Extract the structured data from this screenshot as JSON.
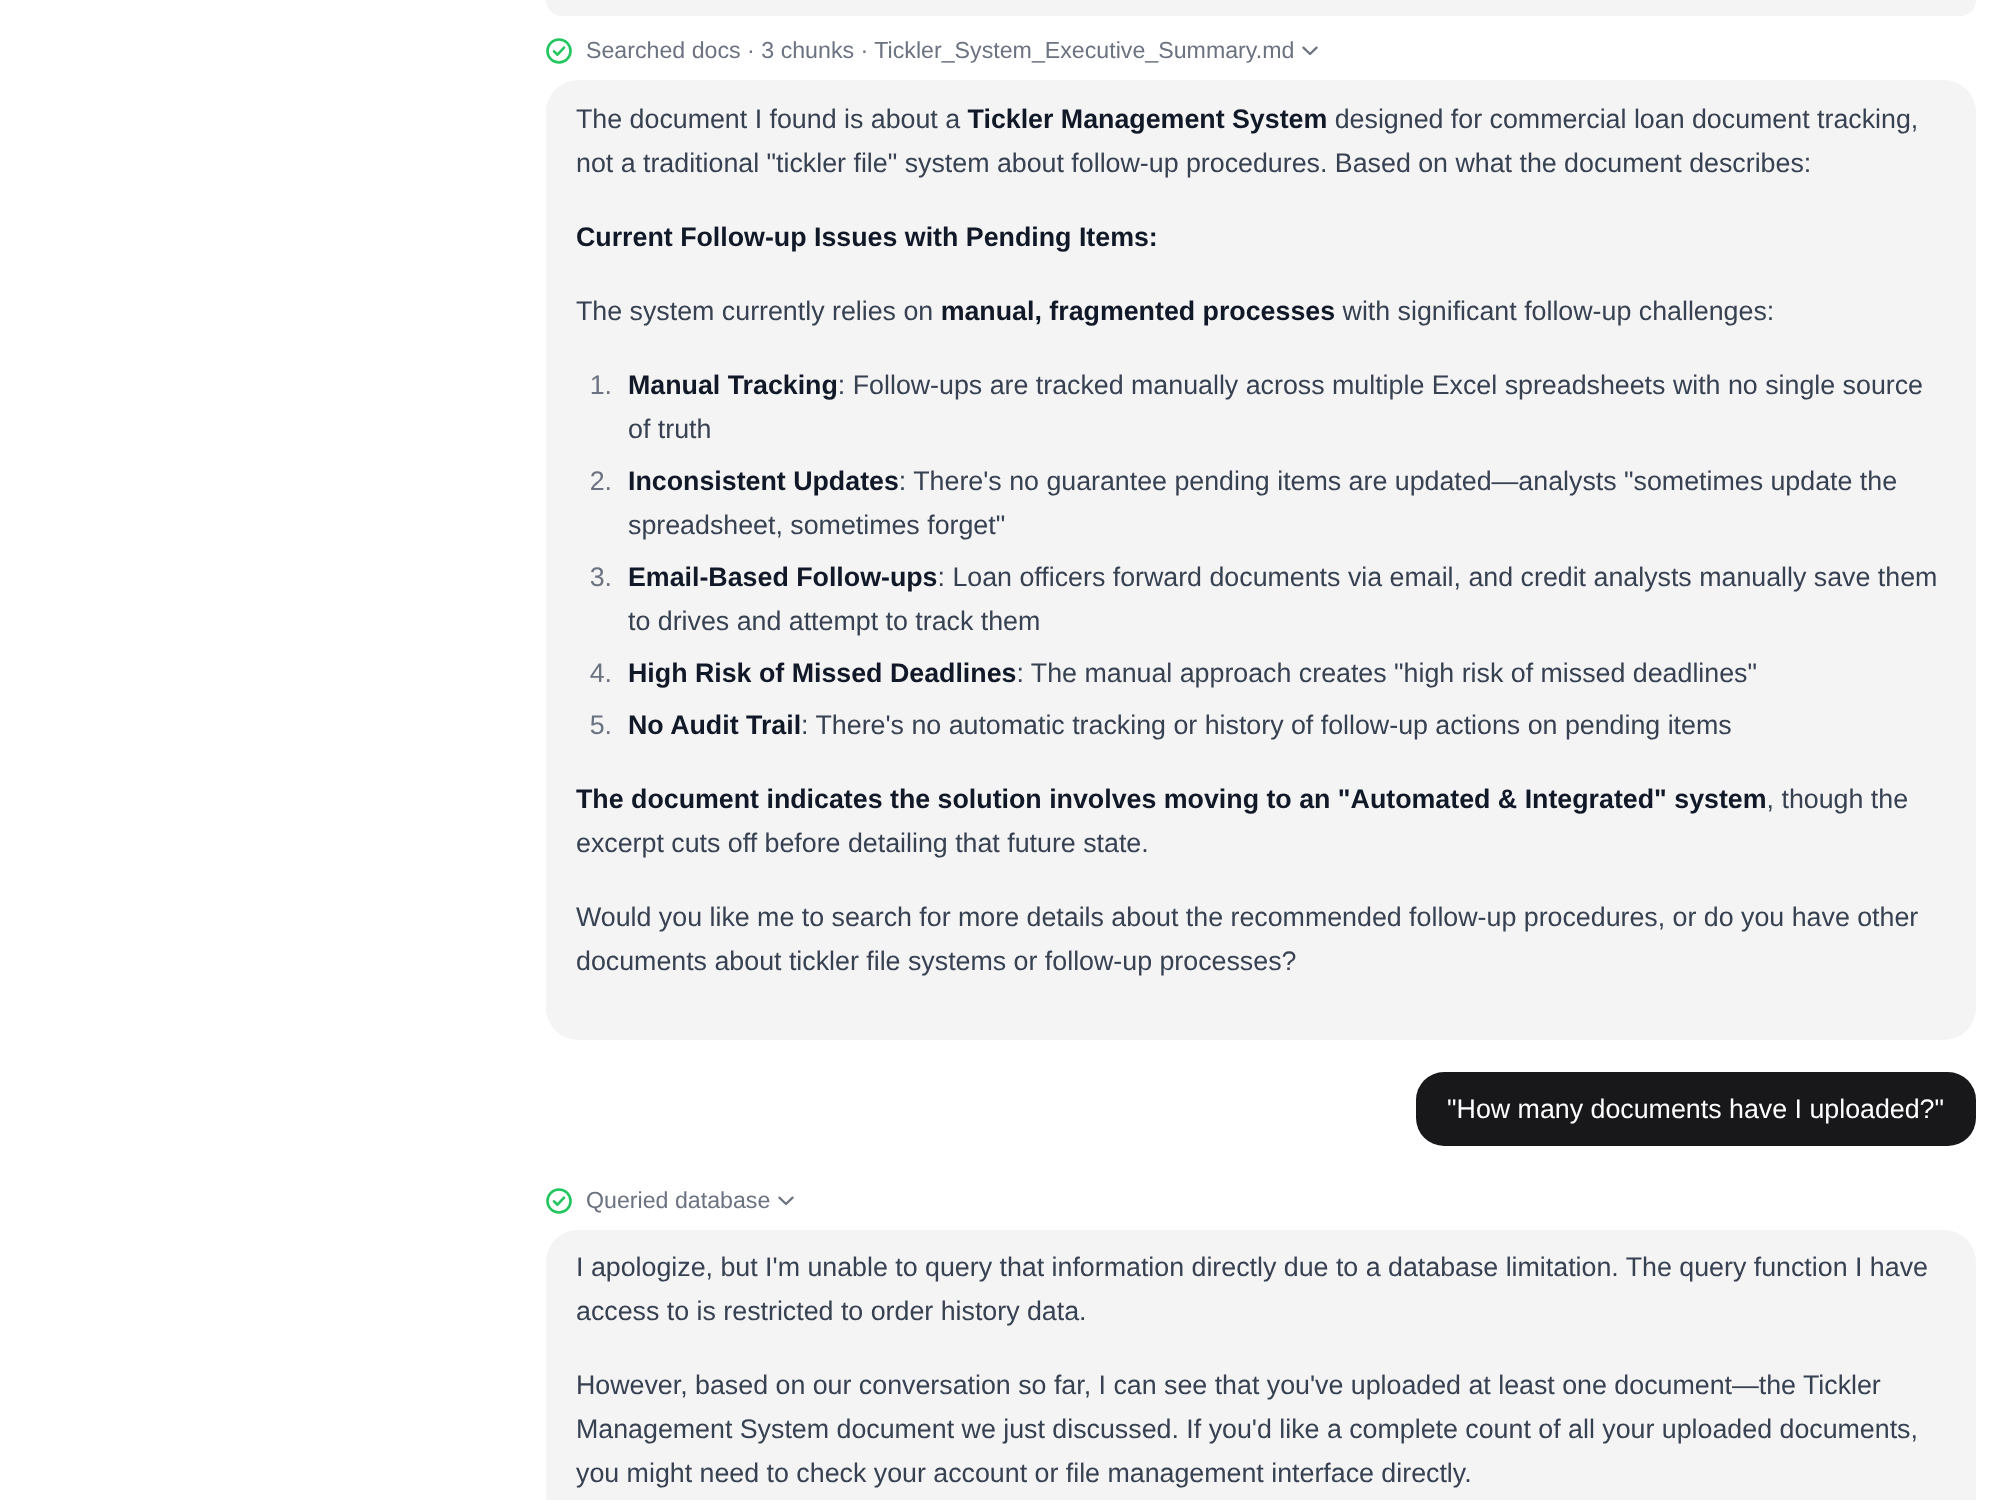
{
  "conversation": {
    "messages": [
      {
        "kind": "assistant",
        "cut_off": true
      },
      {
        "kind": "assistant",
        "tool_status": {
          "done": true,
          "text": "Searched docs · 3 chunks · Tickler_System_Executive_Summary.md",
          "expandable": true
        },
        "blocks": [
          {
            "kind": "paragraph",
            "text": "The document I found is about a **Tickler Management System** designed for commercial loan document tracking, not a traditional \"tickler file\" system about follow-up procedures. Based on what the document describes:"
          },
          {
            "kind": "heading",
            "text": "Current Follow-up Issues with Pending Items:"
          },
          {
            "kind": "paragraph",
            "text": "The system currently relies on **manual, fragmented processes** with significant follow-up challenges:"
          },
          {
            "kind": "list",
            "items": [
              {
                "number": "1.",
                "text": "**Manual Tracking**: Follow-ups are tracked manually across multiple Excel spreadsheets with no single source of truth"
              },
              {
                "number": "2.",
                "text": "**Inconsistent Updates**: There's no guarantee pending items are updated—analysts \"sometimes update the spreadsheet, sometimes forget\""
              },
              {
                "number": "3.",
                "text": "**Email-Based Follow-ups**: Loan officers forward documents via email, and credit analysts manually save them to drives and attempt to track them"
              },
              {
                "number": "4.",
                "text": "**High Risk of Missed Deadlines**: The manual approach creates \"high risk of missed deadlines\""
              },
              {
                "number": "5.",
                "text": "**No Audit Trail**: There's no automatic tracking or history of follow-up actions on pending items"
              }
            ]
          },
          {
            "kind": "paragraph",
            "text": "**The document indicates the solution involves moving to an \"Automated & Integrated\" system**, though the excerpt cuts off before detailing that future state."
          },
          {
            "kind": "paragraph",
            "text": "Would you like me to search for more details about the recommended follow-up procedures, or do you have other documents about tickler file systems or follow-up processes?"
          }
        ]
      },
      {
        "kind": "user",
        "text": "\"How many documents have I uploaded?\""
      },
      {
        "kind": "assistant",
        "tool_status": {
          "done": true,
          "text": "Queried database",
          "expandable": true
        },
        "blocks": [
          {
            "kind": "paragraph",
            "text": "I apologize, but I'm unable to query that information directly due to a database limitation. The query function I have access to is restricted to order history data."
          },
          {
            "kind": "paragraph",
            "text": "However, based on our conversation so far, I can see that you've uploaded at least one document—the Tickler Management System document we just discussed. If you'd like a complete count of all your uploaded documents, you might need to check your account or file management interface directly."
          }
        ]
      }
    ]
  }
}
